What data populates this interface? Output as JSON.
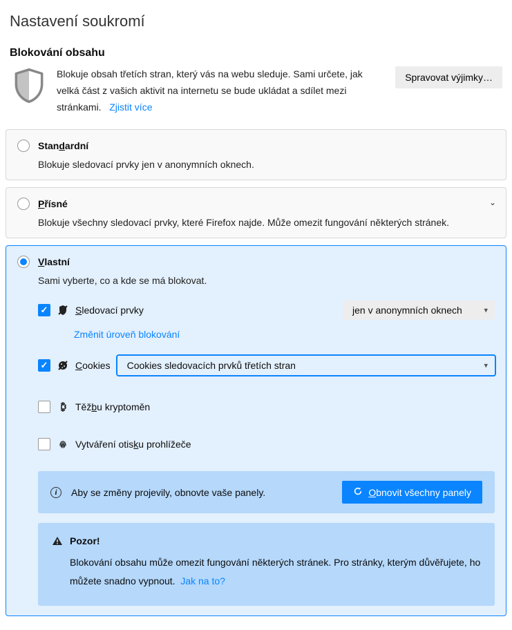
{
  "page_title": "Nastavení soukromí",
  "section_title": "Blokování obsahu",
  "intro": {
    "text": "Blokuje obsah třetích stran, který vás na webu sleduje. Sami určete, jak velká část z vašich aktivit na internetu se bude ukládat a sdílet mezi stránkami.",
    "learn_more": "Zjistit více"
  },
  "manage_exceptions": "Spravovat výjimky…",
  "options": {
    "standard": {
      "title_pre": "Stan",
      "title_ul": "d",
      "title_post": "ardní",
      "desc": "Blokuje sledovací prvky jen v anonymních oknech."
    },
    "strict": {
      "title_ul": "P",
      "title_post": "řísné",
      "desc": "Blokuje všechny sledovací prvky, které Firefox najde. Může omezit fungování některých stránek."
    },
    "custom": {
      "title_ul": "V",
      "title_post": "lastní",
      "desc": "Sami vyberte, co a kde se má blokovat."
    }
  },
  "custom_rows": {
    "trackers": {
      "label_ul": "S",
      "label_post": "ledovací prvky",
      "dropdown": "jen v anonymních oknech"
    },
    "change_level": "Změnit úroveň blokování",
    "cookies": {
      "label_ul": "C",
      "label_post": "ookies",
      "dropdown": "Cookies sledovacích prvků třetích stran"
    },
    "cryptominers": {
      "label_pre": "Těž",
      "label_ul": "b",
      "label_post": "u kryptoměn"
    },
    "fingerprinting": {
      "label_pre": "Vytváření otis",
      "label_ul": "k",
      "label_post": "u prohlížeče"
    }
  },
  "reload_notice": {
    "text": "Aby se změny projevily, obnovte vaše panely.",
    "button_ul": "O",
    "button_post": "bnovit všechny panely"
  },
  "warning": {
    "title": "Pozor!",
    "body": "Blokování obsahu může omezit fungování některých stránek. Pro stránky, kterým důvěřujete, ho můžete snadno vypnout.",
    "link": "Jak na to?"
  }
}
